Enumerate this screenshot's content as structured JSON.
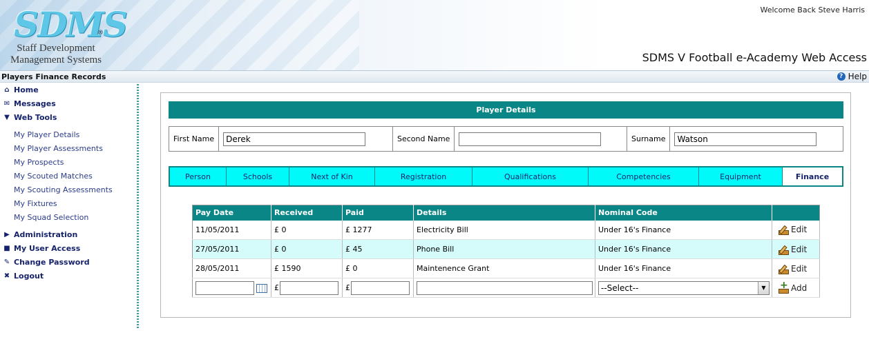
{
  "header": {
    "logo_mark": "SDMS",
    "logo_reg": "®",
    "logo_line1": "Staff Development",
    "logo_line2": "Management Systems",
    "welcome": "Welcome Back Steve Harris",
    "app_title": "SDMS V Football e-Academy Web Access"
  },
  "titlebar": {
    "page_title": "Players Finance Records",
    "help_label": "Help"
  },
  "sidebar": {
    "main_items": [
      {
        "label": "Home",
        "icon": "home-icon"
      },
      {
        "label": "Messages",
        "icon": "messages-icon"
      },
      {
        "label": "Web Tools",
        "icon": "triangle-down-icon"
      }
    ],
    "sub_items": [
      "My Player Details",
      "My Player Assessments",
      "My Prospects",
      "My Scouted Matches",
      "My Scouting Assessments",
      "My Fixtures",
      "My Squad Selection"
    ],
    "bottom_items": [
      {
        "label": "Administration",
        "icon": "triangle-right-icon"
      },
      {
        "label": "My User Access",
        "icon": "lock-icon"
      },
      {
        "label": "Change Password",
        "icon": "key-icon"
      },
      {
        "label": "Logout",
        "icon": "x-icon"
      }
    ]
  },
  "player_details": {
    "title": "Player Details",
    "first_name_label": "First Name",
    "first_name_value": "Derek",
    "second_name_label": "Second Name",
    "second_name_value": "",
    "surname_label": "Surname",
    "surname_value": "Watson"
  },
  "tabs": [
    "Person",
    "Schools",
    "Next of Kin",
    "Registration",
    "Qualifications",
    "Competencies",
    "Equipment",
    "Finance"
  ],
  "finance": {
    "columns": [
      "Pay Date",
      "Received",
      "Paid",
      "Details",
      "Nominal Code",
      ""
    ],
    "rows": [
      {
        "date": "11/05/2011",
        "received": "£ 0",
        "paid": "£ 1277",
        "details": "Electricity Bill",
        "code": "Under 16's Finance",
        "action": "Edit"
      },
      {
        "date": "27/05/2011",
        "received": "£ 0",
        "paid": "£ 45",
        "details": "Phone Bill",
        "code": "Under 16's Finance",
        "action": "Edit"
      },
      {
        "date": "28/05/2011",
        "received": "£ 1590",
        "paid": "£ 0",
        "details": "Maintenence Grant",
        "code": "Under 16's Finance",
        "action": "Edit"
      }
    ],
    "add_row": {
      "currency_symbol": "£",
      "select_value": "--Select--",
      "add_label": "Add"
    }
  },
  "colors": {
    "teal": "#0b8686",
    "cyan_tab": "#00fafa",
    "alt_row": "#d6fbfb",
    "nav_text": "#16236b"
  }
}
